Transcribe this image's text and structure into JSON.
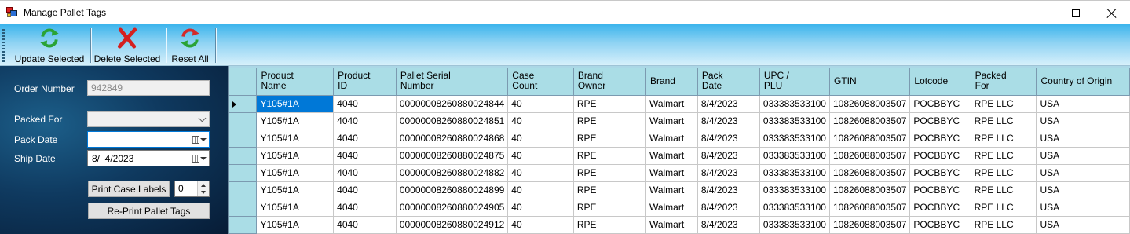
{
  "window": {
    "title": "Manage Pallet Tags"
  },
  "toolbar": {
    "update_label": "Update Selected",
    "delete_label": "Delete Selected",
    "reset_label": "Reset All"
  },
  "form": {
    "order_number_label": "Order Number",
    "order_number_value": "942849",
    "packed_for_label": "Packed For",
    "packed_for_value": "",
    "pack_date_label": "Pack Date",
    "pack_date_value": "",
    "ship_date_label": "Ship Date",
    "ship_date_value": "8/  4/2023",
    "print_case_labels": "Print Case Labels",
    "case_count_value": "0",
    "reprint_pallet_tags": "Re-Print Pallet Tags"
  },
  "grid": {
    "columns": [
      [
        "Product",
        "Name"
      ],
      [
        "Product",
        "ID"
      ],
      [
        "Pallet Serial",
        "Number"
      ],
      [
        "Case",
        "Count"
      ],
      [
        "Brand",
        "Owner"
      ],
      [
        "Brand",
        ""
      ],
      [
        "Pack",
        "Date"
      ],
      [
        "UPC /",
        "PLU"
      ],
      [
        "GTIN",
        ""
      ],
      [
        "Lotcode",
        ""
      ],
      [
        "Packed",
        "For"
      ],
      [
        "Country of Origin",
        ""
      ]
    ],
    "rows": [
      [
        "Y105#1A",
        "4040",
        "00000008260880024844",
        "40",
        "RPE",
        "Walmart",
        "8/4/2023",
        "033383533100",
        "10826088003507",
        "POCBBYC",
        "RPE LLC",
        "USA"
      ],
      [
        "Y105#1A",
        "4040",
        "00000008260880024851",
        "40",
        "RPE",
        "Walmart",
        "8/4/2023",
        "033383533100",
        "10826088003507",
        "POCBBYC",
        "RPE LLC",
        "USA"
      ],
      [
        "Y105#1A",
        "4040",
        "00000008260880024868",
        "40",
        "RPE",
        "Walmart",
        "8/4/2023",
        "033383533100",
        "10826088003507",
        "POCBBYC",
        "RPE LLC",
        "USA"
      ],
      [
        "Y105#1A",
        "4040",
        "00000008260880024875",
        "40",
        "RPE",
        "Walmart",
        "8/4/2023",
        "033383533100",
        "10826088003507",
        "POCBBYC",
        "RPE LLC",
        "USA"
      ],
      [
        "Y105#1A",
        "4040",
        "00000008260880024882",
        "40",
        "RPE",
        "Walmart",
        "8/4/2023",
        "033383533100",
        "10826088003507",
        "POCBBYC",
        "RPE LLC",
        "USA"
      ],
      [
        "Y105#1A",
        "4040",
        "00000008260880024899",
        "40",
        "RPE",
        "Walmart",
        "8/4/2023",
        "033383533100",
        "10826088003507",
        "POCBBYC",
        "RPE LLC",
        "USA"
      ],
      [
        "Y105#1A",
        "4040",
        "00000008260880024905",
        "40",
        "RPE",
        "Walmart",
        "8/4/2023",
        "033383533100",
        "10826088003507",
        "POCBBYC",
        "RPE LLC",
        "USA"
      ],
      [
        "Y105#1A",
        "4040",
        "00000008260880024912",
        "40",
        "RPE",
        "Walmart",
        "8/4/2023",
        "033383533100",
        "10826088003507",
        "POCBBYC",
        "RPE LLC",
        "USA"
      ]
    ],
    "selected_row": 0,
    "selected_col": 0
  },
  "colors": {
    "selection": "#0078d7",
    "header": "#aadde6",
    "toolbar_top": "#3cb4ec",
    "panel_dark": "#0f3a60"
  }
}
